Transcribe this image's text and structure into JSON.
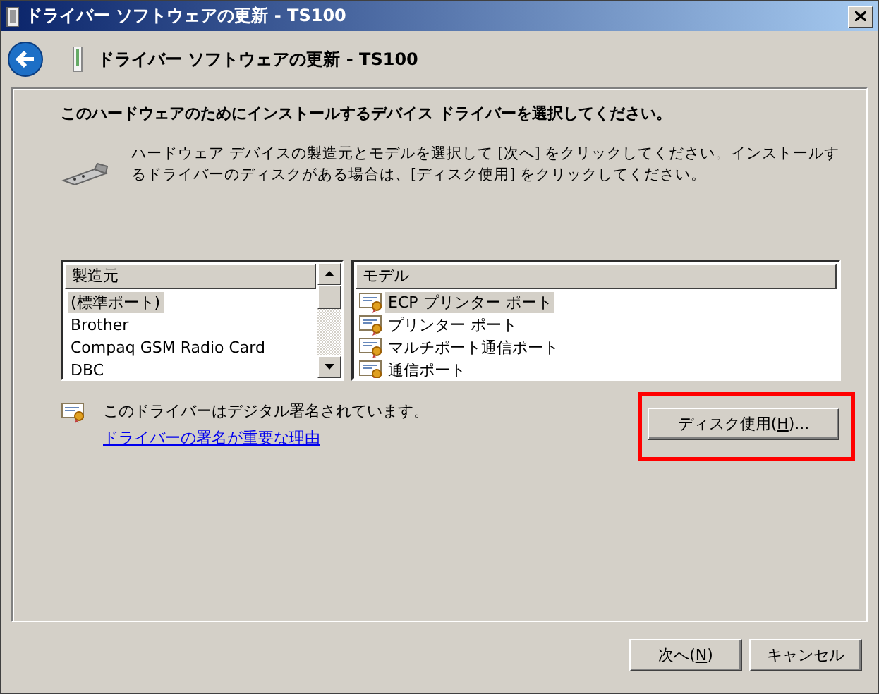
{
  "window": {
    "title": "ドライバー ソフトウェアの更新 - TS100"
  },
  "header": {
    "title": "ドライバー ソフトウェアの更新 - TS100"
  },
  "heading": "このハードウェアのためにインストールするデバイス ドライバーを選択してください。",
  "description": "ハードウェア デバイスの製造元とモデルを選択して [次へ] をクリックしてください。インストールするドライバーのディスクがある場合は、[ディスク使用] をクリックしてください。",
  "manufacturers": {
    "header": "製造元",
    "items": [
      {
        "label": "(標準ポート)",
        "selected": true
      },
      {
        "label": "Brother",
        "selected": false
      },
      {
        "label": "Compaq GSM Radio Card",
        "selected": false
      },
      {
        "label": "DBC",
        "selected": false
      }
    ]
  },
  "models": {
    "header": "モデル",
    "items": [
      {
        "label": "ECP プリンター ポート",
        "selected": true
      },
      {
        "label": "プリンター ポート",
        "selected": false
      },
      {
        "label": "マルチポート通信ポート",
        "selected": false
      },
      {
        "label": "通信ポート",
        "selected": false
      }
    ]
  },
  "signature": {
    "text": "このドライバーはデジタル署名されています。",
    "link": "ドライバーの署名が重要な理由"
  },
  "disk_button": {
    "label": "ディスク使用(",
    "mnemonic": "H",
    "suffix": ")..."
  },
  "buttons": [
    {
      "label": "次へ(",
      "mnemonic": "N",
      "suffix": ")"
    },
    {
      "label": "キャンセル"
    }
  ]
}
